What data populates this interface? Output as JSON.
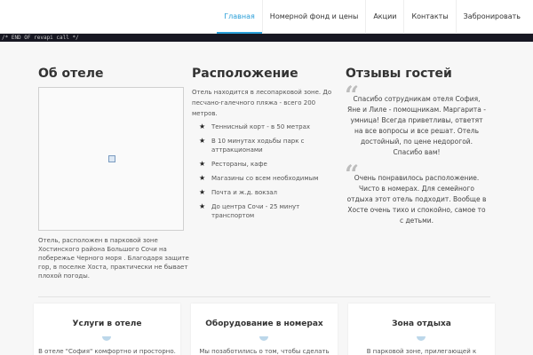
{
  "nav": {
    "items": [
      "Главная",
      "Номерной фонд и цены",
      "Акции",
      "Контакты",
      "Забронировать"
    ]
  },
  "code_strip": "/* END OF revapi call */",
  "about": {
    "title": "Об отеле",
    "text": "Отель, расположен в парковой зоне Хостинского района Большого Сочи на побережье Черного моря . Благодаря защите гор, в поселке Хоста, практически не бывает плохой погоды."
  },
  "location": {
    "title": "Расположение",
    "intro": "Отель находится в лесопарковой зоне. До песчано-галечного пляжа - всего 200 метров.",
    "items": [
      "Теннисный корт - в 50 метрах",
      "В 10 минутах ходьбы парк с аттракционами",
      "Рестораны, кафе",
      "Магазины со всем необходимым",
      "Почта и ж.д. вокзал",
      "До центра Сочи - 25 минут транспортом"
    ]
  },
  "reviews": {
    "title": "Отзывы гостей",
    "items": [
      "Спасибо сотрудникам отеля София, Яне и Лиле - помощникам. Маргарита - умница! Всегда приветливы, ответят на все вопросы и все решат. Отель достойный, по цене недорогой. Спасибо вам!",
      "Очень понравилось расположение. Чисто в номерах. Для семейного отдыха этот отель подходит. Вообще в Хосте очень тихо и спокойно, самое то с детьми."
    ]
  },
  "features": [
    {
      "title": "Услуги в отеле",
      "text": "В отеле \"София\" комфортно и просторно."
    },
    {
      "title": "Оборудование в номерах",
      "text": "Мы позаботились о том, чтобы сделать"
    },
    {
      "title": "Зона отдыха",
      "text": "В парковой зоне, прилегающей к"
    }
  ],
  "colors": {
    "accent": "#2a9fd8",
    "dark_strip": "#171722"
  },
  "icons": {
    "bullet": "star-icon",
    "quote": "quote-icon",
    "map": "broken-image-icon"
  }
}
